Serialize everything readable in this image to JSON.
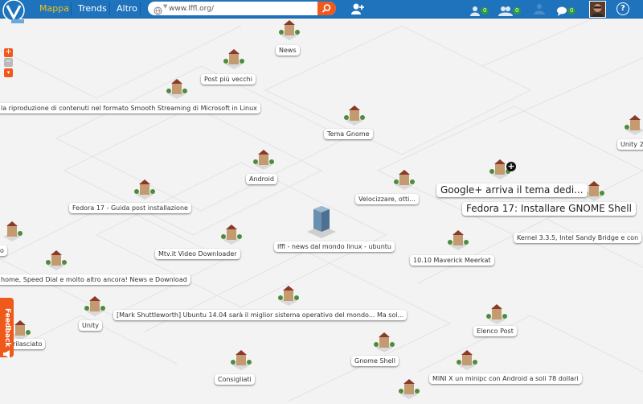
{
  "topbar": {
    "nav": [
      "Mappa",
      "Trends",
      "Altro"
    ],
    "search_value": "www.lffl.org/",
    "counters": [
      "0",
      "0",
      "0"
    ]
  },
  "map": {
    "labels": [
      "News",
      "Post più vecchi",
      "la riproduzione di contenuti nel formato Smooth Streaming di Microsoft in Linux",
      "Tema Gnome",
      "Unity 2",
      "Android",
      "Velocizzare, otti...",
      "Google+ arriva il tema dedi...",
      "Fedora 17: Installare GNOME Shell",
      "Kernel 3.3.5, Intel Sandy Bridge e con",
      "Fedora 17 - Guida post installazione",
      "lffl - news dal mondo linux - ubuntu",
      "Mtv.it Video Downloader",
      "10.10 Maverick Meerkat",
      "o",
      "home, Speed Dial e molto altro ancora! News e Download",
      "Unity",
      "[Mark Shuttleworth] Ubuntu 14.04 sarà il miglior sistema operativo del mondo... Ma sol...",
      "Elenco Post",
      "rilasciato",
      "Gnome Shell",
      "Consigliati",
      "MINI X un minipc con Android a soli 78 dollari"
    ]
  },
  "feedback_label": "Feedback"
}
